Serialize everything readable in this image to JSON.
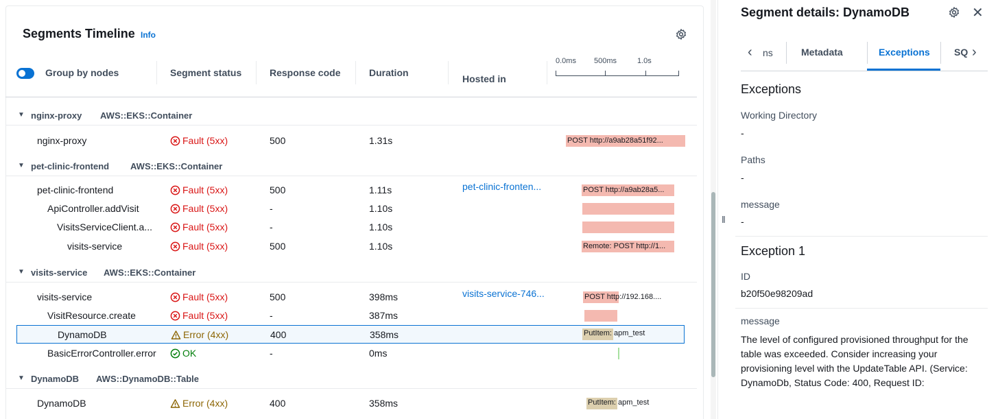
{
  "timeline": {
    "title": "Segments Timeline",
    "info_link": "Info",
    "toggle_label": "Group by nodes",
    "columns": {
      "status": "Segment status",
      "response": "Response code",
      "duration": "Duration",
      "hosted": "Hosted in"
    },
    "scale_ticks": [
      "0.0ms",
      "500ms",
      "1.0s"
    ],
    "groups": [
      {
        "name": "nginx-proxy",
        "type": "AWS::EKS::Container"
      },
      {
        "name": "pet-clinic-frontend",
        "type": "AWS::EKS::Container"
      },
      {
        "name": "visits-service",
        "type": "AWS::EKS::Container"
      },
      {
        "name": "DynamoDB",
        "type": "AWS::DynamoDB::Table"
      }
    ],
    "rows": [
      {
        "name": "nginx-proxy",
        "status": "Fault (5xx)",
        "code": "500",
        "duration": "1.31s",
        "hosted": "",
        "bar": "POST http://a9ab28a51f92..."
      },
      {
        "name": "pet-clinic-frontend",
        "status": "Fault (5xx)",
        "code": "500",
        "duration": "1.11s",
        "hosted": "pet-clinic-fronten...",
        "bar": "POST http://a9ab28a5..."
      },
      {
        "name": "ApiController.addVisit",
        "status": "Fault (5xx)",
        "code": "-",
        "duration": "1.10s",
        "hosted": "",
        "bar": ""
      },
      {
        "name": "VisitsServiceClient.a...",
        "status": "Fault (5xx)",
        "code": "-",
        "duration": "1.10s",
        "hosted": "",
        "bar": ""
      },
      {
        "name": "visits-service",
        "status": "Fault (5xx)",
        "code": "500",
        "duration": "1.10s",
        "hosted": "",
        "bar": "Remote: POST http://1..."
      },
      {
        "name": "visits-service",
        "status": "Fault (5xx)",
        "code": "500",
        "duration": "398ms",
        "hosted": "visits-service-746...",
        "bar": "POST http://192.168...."
      },
      {
        "name": "VisitResource.create",
        "status": "Fault (5xx)",
        "code": "-",
        "duration": "387ms",
        "hosted": "",
        "bar": ""
      },
      {
        "name": "DynamoDB",
        "status": "Error (4xx)",
        "code": "400",
        "duration": "358ms",
        "hosted": "",
        "bar": "PutItem: apm_test"
      },
      {
        "name": "BasicErrorController.error",
        "status": "OK",
        "code": "-",
        "duration": "0ms",
        "hosted": "",
        "bar": ""
      },
      {
        "name": "DynamoDB",
        "status": "Error (4xx)",
        "code": "400",
        "duration": "358ms",
        "hosted": "",
        "bar": "PutItem: apm_test"
      }
    ]
  },
  "details": {
    "title": "Segment details: DynamoDB",
    "tabs": [
      "ns",
      "Metadata",
      "Exceptions",
      "SQ"
    ],
    "active_tab": "Exceptions",
    "section_heading": "Exceptions",
    "fields": [
      {
        "label": "Working Directory",
        "value": "-"
      },
      {
        "label": "Paths",
        "value": "-"
      },
      {
        "label": "message",
        "value": "-"
      }
    ],
    "exception": {
      "heading": "Exception 1",
      "id_label": "ID",
      "id_value": "b20f50e98209ad",
      "message_label": "message",
      "message_value": "The level of configured provisioned throughput for the table was exceeded. Consider increasing your provisioning level with the UpdateTable API. (Service: DynamoDb, Status Code: 400, Request ID:"
    }
  },
  "colors": {
    "accent": "#0972d3",
    "fault": "#d91515",
    "error": "#8d6605",
    "ok": "#037f0c",
    "bar_fault": "#f4b9b0",
    "bar_error": "#dccfae"
  },
  "icons": {
    "settings": "gear-icon",
    "close": "close-icon",
    "fault": "x-circle-icon",
    "error": "warning-triangle-icon",
    "ok": "check-circle-icon"
  }
}
